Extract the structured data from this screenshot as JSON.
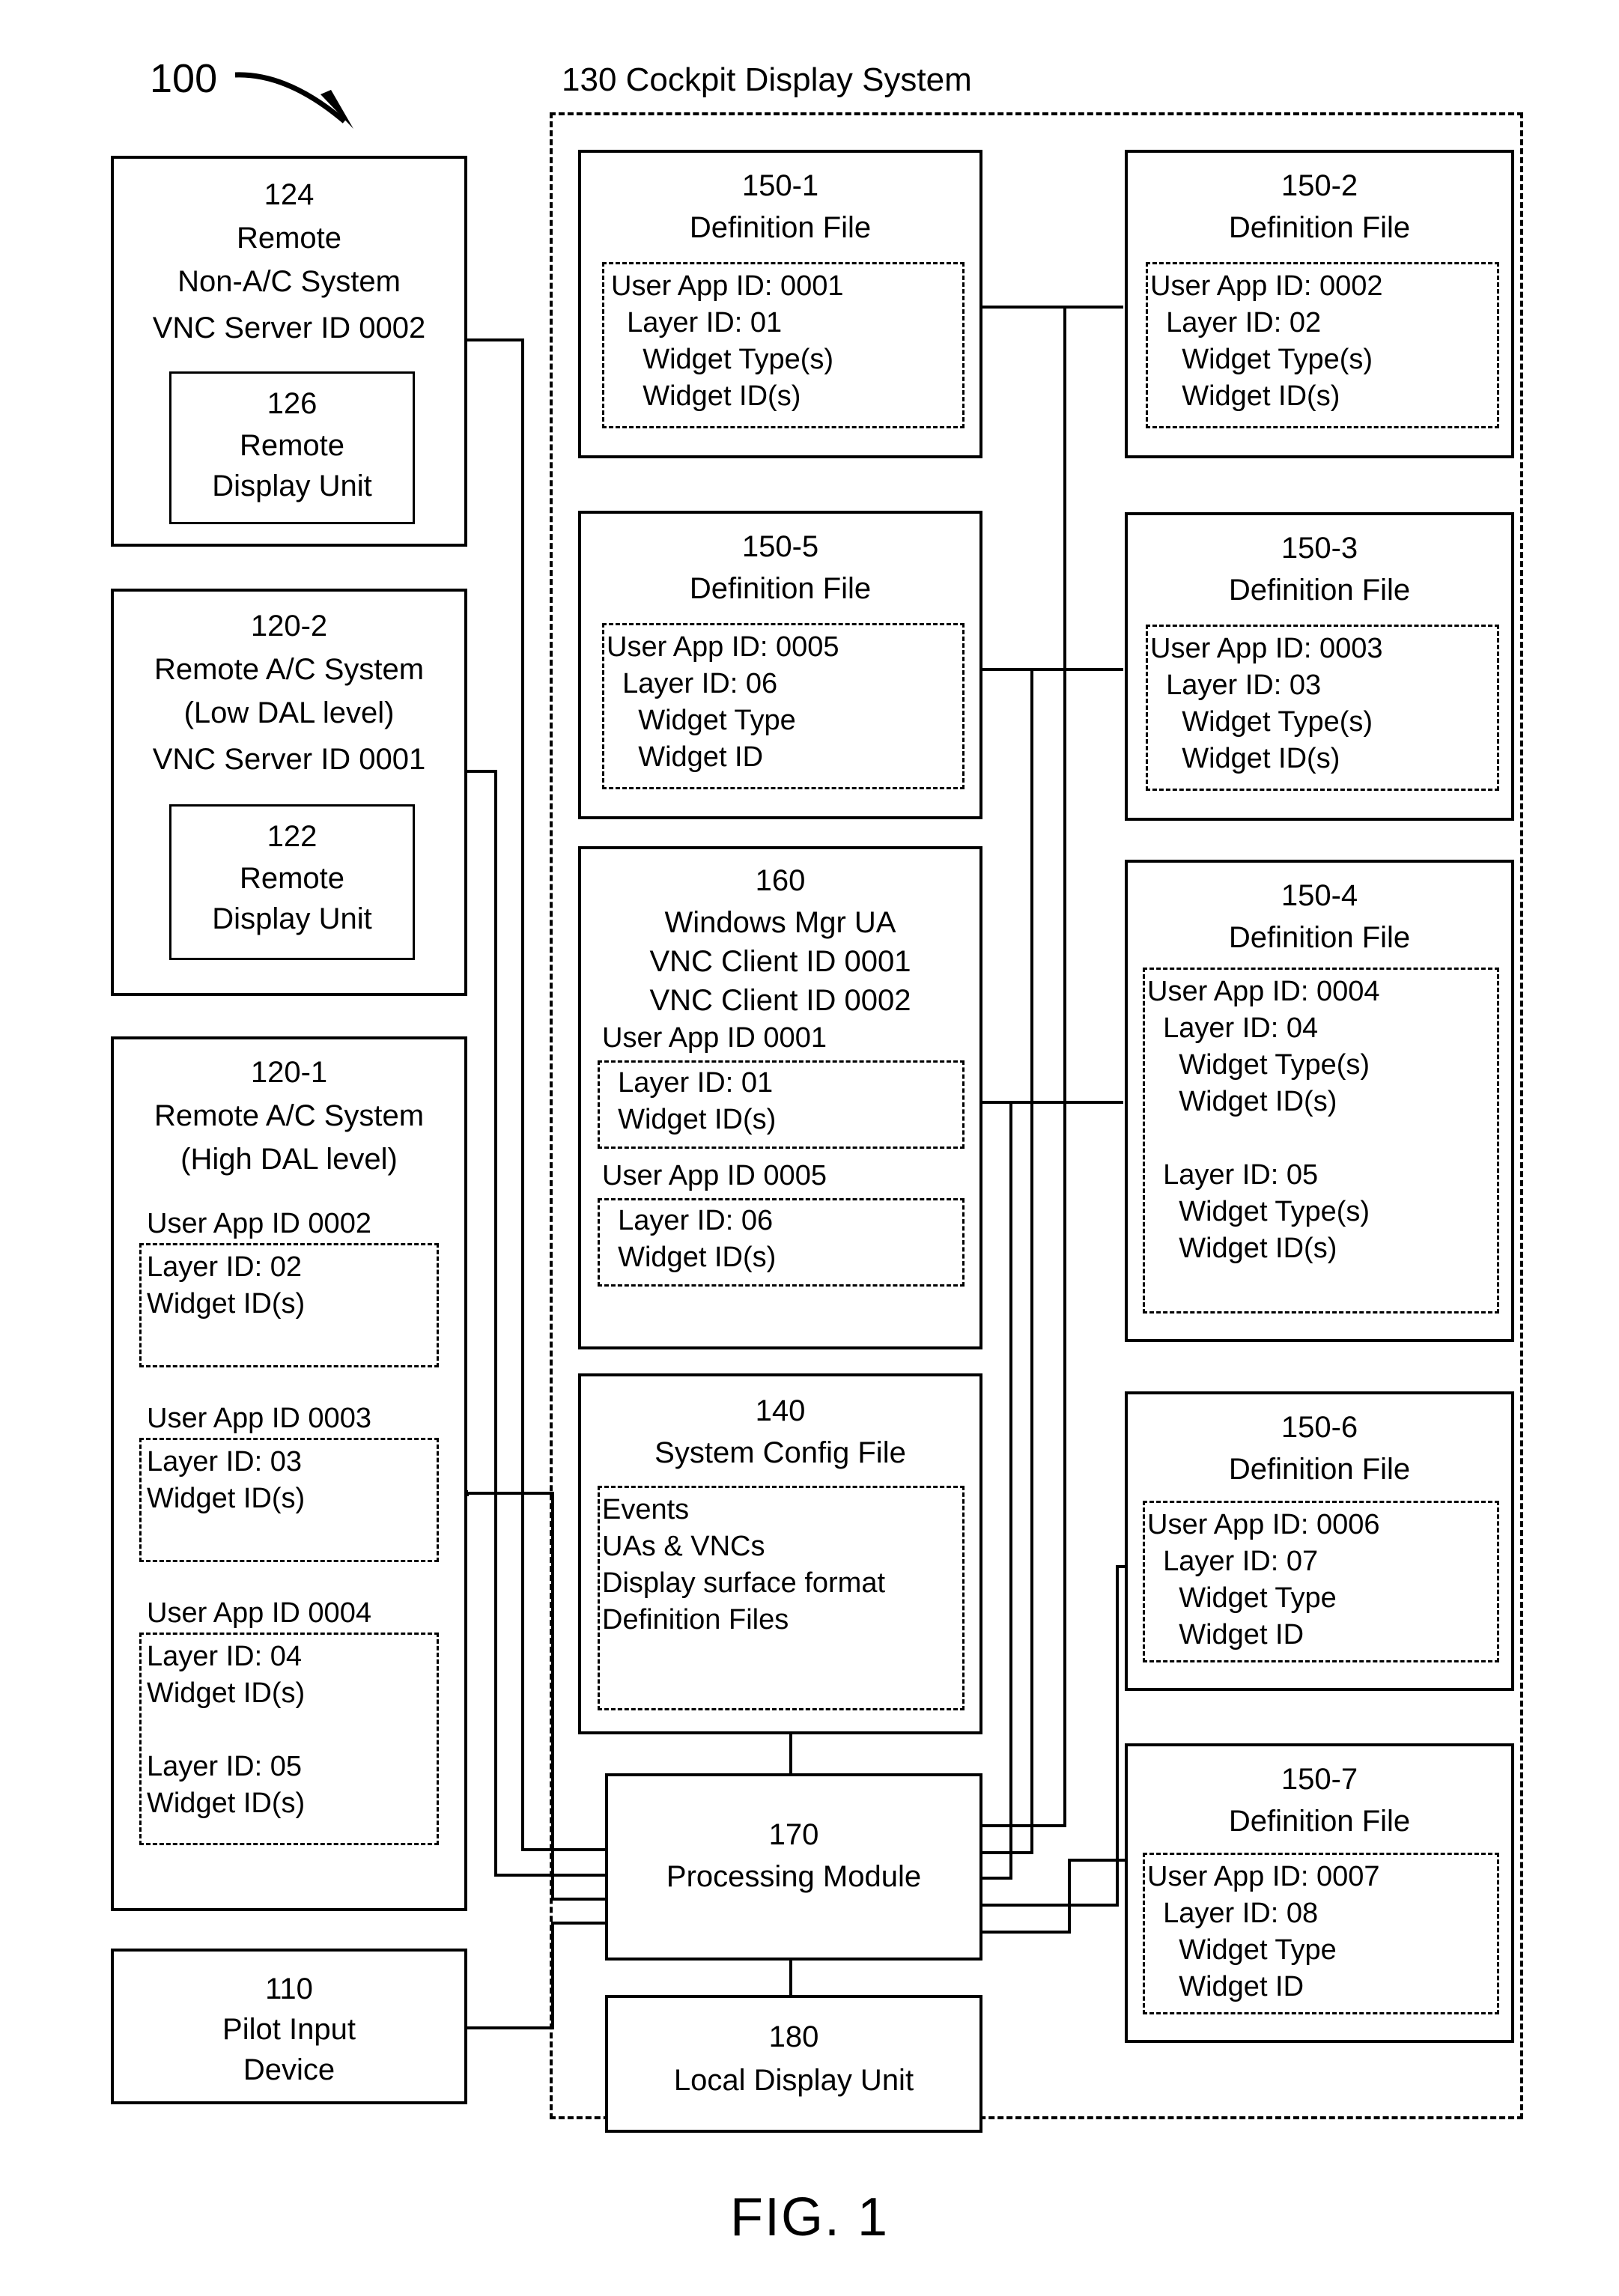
{
  "figure": {
    "caption": "FIG. 1",
    "system_callout": "100",
    "cockpit_label": "130 Cockpit Display System"
  },
  "left_column": {
    "remote_non_ac": {
      "ref": "124",
      "line1": "Remote",
      "line2": "Non-A/C System",
      "line3": "VNC Server ID 0002",
      "inner": {
        "ref": "126",
        "line1": "Remote",
        "line2": "Display Unit"
      }
    },
    "remote_ac_low": {
      "ref": "120-2",
      "line1": "Remote A/C System",
      "line2": "(Low DAL level)",
      "line3": "VNC Server ID 0001",
      "inner": {
        "ref": "122",
        "line1": "Remote",
        "line2": "Display Unit"
      }
    },
    "remote_ac_high": {
      "ref": "120-1",
      "line1": "Remote A/C System",
      "line2": "(High DAL level)",
      "apps": [
        {
          "header": "User App ID 0002",
          "body": "Layer ID: 02\nWidget ID(s)"
        },
        {
          "header": "User App ID 0003",
          "body": "Layer ID: 03\nWidget ID(s)"
        },
        {
          "header": "User App ID 0004",
          "body": "Layer ID: 04\nWidget ID(s)\n\nLayer ID: 05\nWidget ID(s)"
        }
      ]
    },
    "pilot_input": {
      "ref": "110",
      "line1": "Pilot Input",
      "line2": "Device"
    }
  },
  "middle_column": {
    "def_150_1": {
      "ref": "150-1",
      "title": "Definition File",
      "body": "User App ID: 0001\n  Layer ID: 01\n    Widget Type(s)\n    Widget ID(s)"
    },
    "def_150_5": {
      "ref": "150-5",
      "title": "Definition File",
      "body": "User App ID: 0005\n  Layer ID: 06\n    Widget Type\n    Widget ID"
    },
    "windows_mgr": {
      "ref": "160",
      "line1": "Windows Mgr UA",
      "line2": "VNC Client ID 0001",
      "line3": "VNC Client ID 0002",
      "app1_header": "User App ID 0001",
      "app1_body": "  Layer ID: 01\n  Widget ID(s)",
      "app2_header": "User App ID 0005",
      "app2_body": "  Layer ID: 06\n  Widget ID(s)"
    },
    "sys_config": {
      "ref": "140",
      "title": "System Config File",
      "body": "Events\nUAs & VNCs\nDisplay surface format\nDefinition Files"
    },
    "processing_module": {
      "ref": "170",
      "title": "Processing Module"
    },
    "local_display": {
      "ref": "180",
      "title": "Local Display Unit"
    }
  },
  "right_column": {
    "def_150_2": {
      "ref": "150-2",
      "title": "Definition File",
      "body": "User App ID: 0002\n  Layer ID: 02\n    Widget Type(s)\n    Widget ID(s)"
    },
    "def_150_3": {
      "ref": "150-3",
      "title": "Definition File",
      "body": "User App ID: 0003\n  Layer ID: 03\n    Widget Type(s)\n    Widget ID(s)"
    },
    "def_150_4": {
      "ref": "150-4",
      "title": "Definition File",
      "body": "User App ID: 0004\n  Layer ID: 04\n    Widget Type(s)\n    Widget ID(s)\n\n  Layer ID: 05\n    Widget Type(s)\n    Widget ID(s)"
    },
    "def_150_6": {
      "ref": "150-6",
      "title": "Definition File",
      "body": "User App ID: 0006\n  Layer ID: 07\n    Widget Type\n    Widget ID"
    },
    "def_150_7": {
      "ref": "150-7",
      "title": "Definition File",
      "body": "User App ID: 0007\n  Layer ID: 08\n    Widget Type\n    Widget ID"
    }
  }
}
